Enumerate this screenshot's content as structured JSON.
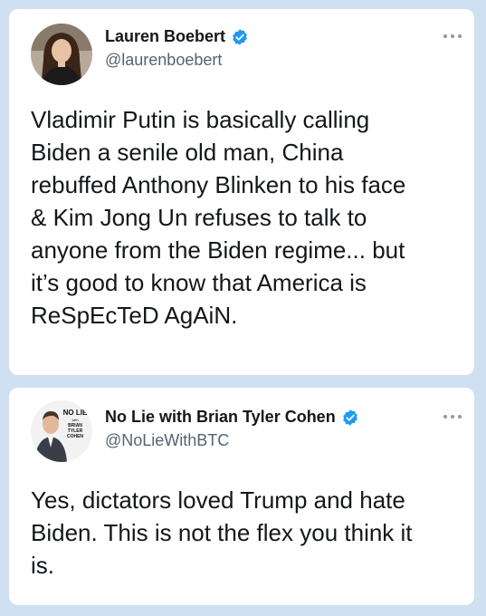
{
  "colors": {
    "background": "#cfe0f3",
    "card": "#ffffff",
    "text": "#14171a",
    "handle": "#536471",
    "verified": "#1d9bf0"
  },
  "tweets": [
    {
      "name": "Lauren Boebert",
      "handle": "@laurenboebert",
      "verified_icon": "verified-badge-icon",
      "lines": [
        "Vladimir Putin is basically calling",
        "Biden a senile old man, China",
        "rebuffed Anthony Blinken to his face",
        "& Kim Jong Un refuses to talk to",
        "anyone from the Biden regime... but",
        "it’s good to know that America is",
        "ReSpEcTeD AgAiN."
      ]
    },
    {
      "name": "No Lie with Brian Tyler Cohen",
      "handle": "@NoLieWithBTC",
      "verified_icon": "verified-badge-icon",
      "avatar_logo_lines": [
        "NO LIE",
        "with",
        "BRIAN",
        "TYLER",
        "COHEN"
      ],
      "lines": [
        "Yes, dictators loved Trump and hate",
        "Biden. This is not the flex you think it",
        "is."
      ]
    }
  ]
}
